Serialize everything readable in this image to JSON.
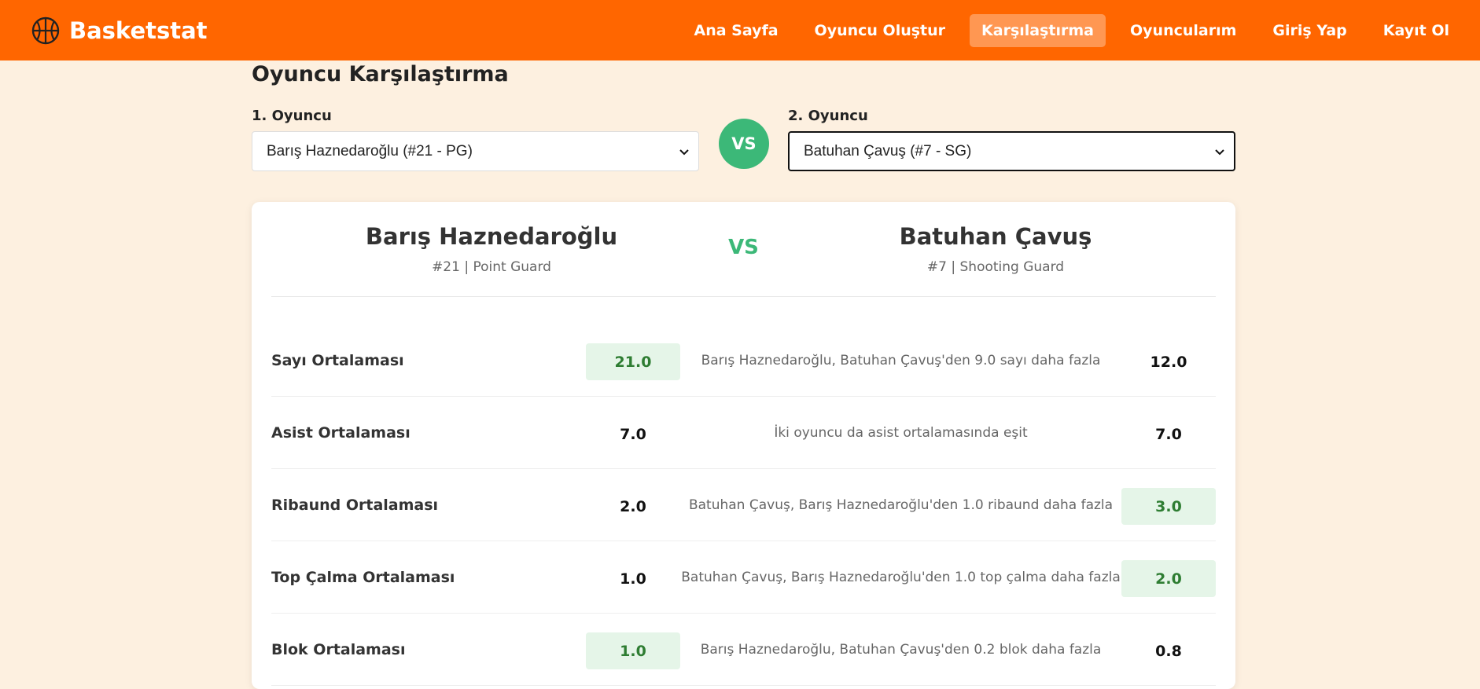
{
  "navbar": {
    "brand": "Basketstat",
    "brand_icon": "basketball-icon",
    "links": [
      {
        "label": "Ana Sayfa",
        "active": false
      },
      {
        "label": "Oyuncu Oluştur",
        "active": false
      },
      {
        "label": "Karşılaştırma",
        "active": true
      },
      {
        "label": "Oyuncularım",
        "active": false
      },
      {
        "label": "Giriş Yap",
        "active": false
      },
      {
        "label": "Kayıt Ol",
        "active": false
      }
    ]
  },
  "page": {
    "title": "Oyuncu Karşılaştırma"
  },
  "selectors": {
    "player1_label": "1. Oyuncu",
    "player1_value": "Barış Haznedaroğlu (#21 - PG)",
    "vs": "VS",
    "player2_label": "2. Oyuncu",
    "player2_value": "Batuhan Çavuş (#7 - SG)"
  },
  "comparison": {
    "player1": {
      "name": "Barış Haznedaroğlu",
      "info": "#21 | Point Guard"
    },
    "vs": "VS",
    "player2": {
      "name": "Batuhan Çavuş",
      "info": "#7 | Shooting Guard"
    },
    "stats": [
      {
        "label": "Sayı Ortalaması",
        "p1": "21.0",
        "p2": "12.0",
        "note": "Barış Haznedaroğlu, Batuhan Çavuş'den 9.0 sayı daha fazla",
        "winner": "p1"
      },
      {
        "label": "Asist Ortalaması",
        "p1": "7.0",
        "p2": "7.0",
        "note": "İki oyuncu da asist ortalamasında eşit",
        "winner": "none"
      },
      {
        "label": "Ribaund Ortalaması",
        "p1": "2.0",
        "p2": "3.0",
        "note": "Batuhan Çavuş, Barış Haznedaroğlu'den 1.0 ribaund daha fazla",
        "winner": "p2"
      },
      {
        "label": "Top Çalma Ortalaması",
        "p1": "1.0",
        "p2": "2.0",
        "note": "Batuhan Çavuş, Barış Haznedaroğlu'den 1.0 top çalma daha fazla",
        "winner": "p2"
      },
      {
        "label": "Blok Ortalaması",
        "p1": "1.0",
        "p2": "0.8",
        "note": "Barış Haznedaroğlu, Batuhan Çavuş'den 0.2 blok daha fazla",
        "winner": "p1"
      }
    ]
  },
  "colors": {
    "nav_bg": "#ff6600",
    "page_bg": "#fdf0e0",
    "accent_green": "#3cb878",
    "win_bg": "#e5f5e8",
    "win_text": "#2e7d32"
  }
}
